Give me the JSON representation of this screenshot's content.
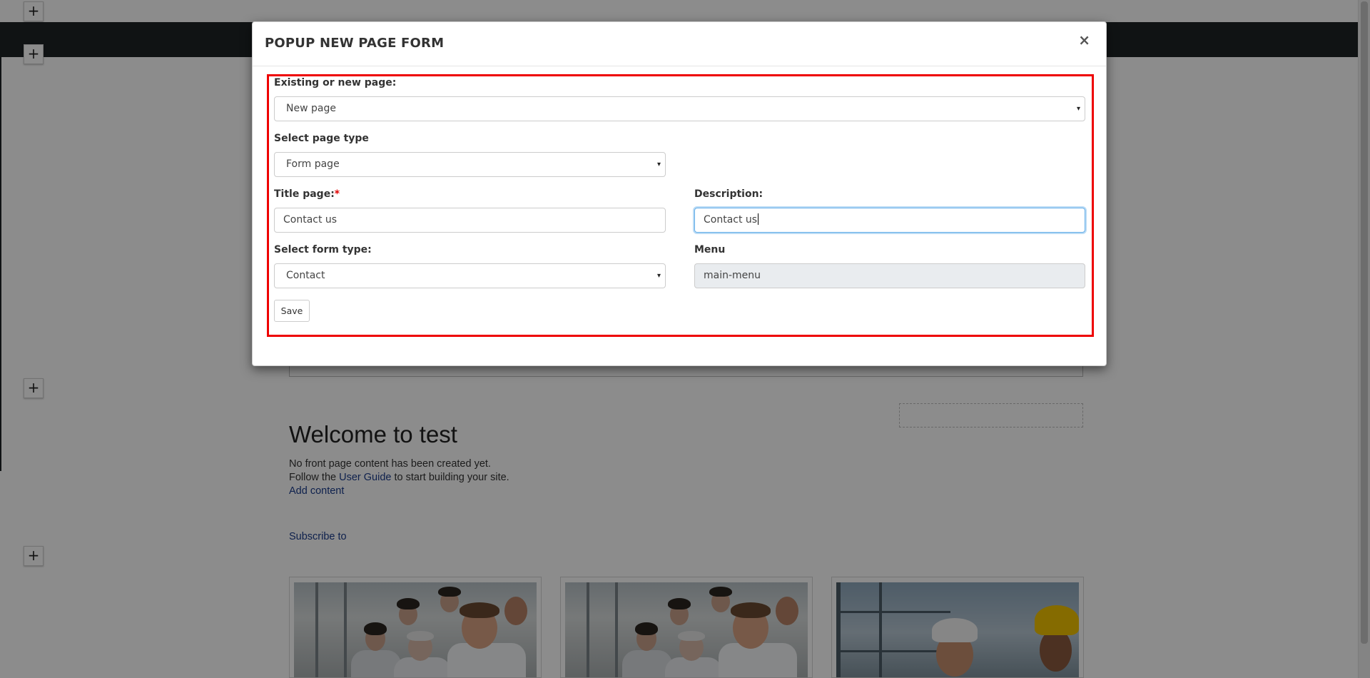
{
  "background": {
    "welcome_heading": "Welcome to test",
    "line1": "No front page content has been created yet.",
    "line2_before": "Follow the",
    "line2_link": "User Guide",
    "line2_after": "to start building your site.",
    "add_content_link": "Add content",
    "subscribe_link": "Subscribe to",
    "add_section_symbol": "+"
  },
  "modal": {
    "title": "POPUP NEW PAGE FORM",
    "close_symbol": "×",
    "fields": {
      "existing_or_new": {
        "label": "Existing or new page:",
        "value": "New page"
      },
      "page_type": {
        "label": "Select page type",
        "value": "Form page"
      },
      "title": {
        "label": "Title page:",
        "required_mark": "*",
        "value": "Contact us"
      },
      "description": {
        "label": "Description:",
        "value": "Contact us"
      },
      "form_type": {
        "label": "Select form type:",
        "value": "Contact"
      },
      "menu": {
        "label": "Menu",
        "value": "main-menu"
      }
    },
    "save_label": "Save",
    "select_caret": "▾"
  },
  "colors": {
    "overlay": "#000000",
    "highlight_frame": "#ee0000",
    "link": "#1b3c8c",
    "focus_border": "#66afe9",
    "navbar": "#1e2326"
  },
  "icons": [
    "plus-icon",
    "close-icon",
    "dropdown-caret-icon"
  ]
}
